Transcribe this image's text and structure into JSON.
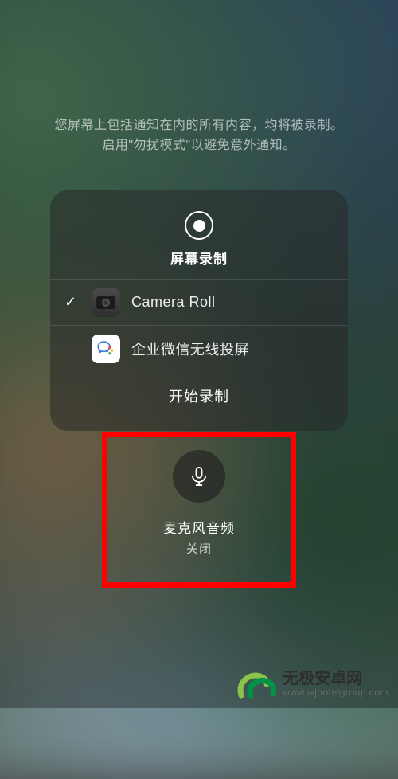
{
  "hint": {
    "line1": "您屏幕上包括通知在内的所有内容，均将被录制。",
    "line2": "启用\"勿扰模式\"以避免意外通知。"
  },
  "panel": {
    "title": "屏幕录制",
    "options": [
      {
        "label": "Camera Roll",
        "selected": true,
        "icon": "camera-roll"
      },
      {
        "label": "企业微信无线投屏",
        "selected": false,
        "icon": "wecom"
      }
    ],
    "start_label": "开始录制"
  },
  "mic": {
    "title": "麦克风音频",
    "state": "关闭"
  },
  "watermark": {
    "name": "无极安卓网",
    "url": "www.wjhotelgroup.com"
  }
}
